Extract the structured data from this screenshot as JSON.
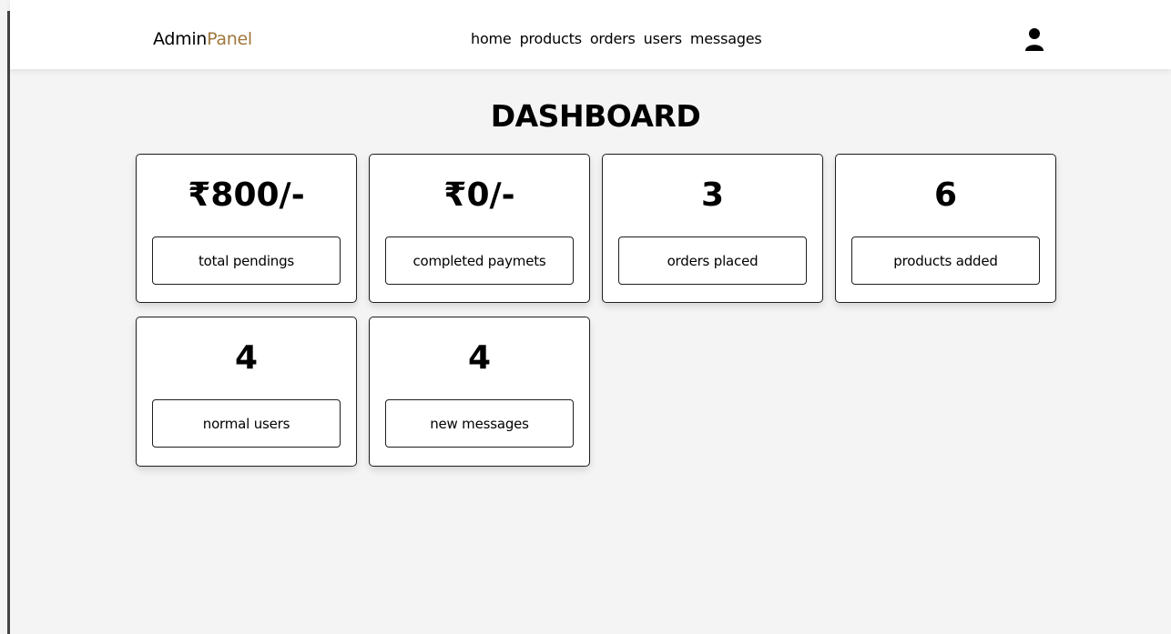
{
  "header": {
    "logo_main": "Admin",
    "logo_accent": "Panel",
    "nav": [
      "home",
      "products",
      "orders",
      "users",
      "messages"
    ],
    "user_icon": "user-icon"
  },
  "page": {
    "title": "DASHBOARD"
  },
  "stats": [
    {
      "value": "₹800/-",
      "label": "total pendings"
    },
    {
      "value": "₹0/-",
      "label": "completed paymets"
    },
    {
      "value": "3",
      "label": "orders placed"
    },
    {
      "value": "6",
      "label": "products added"
    },
    {
      "value": "4",
      "label": "normal users"
    },
    {
      "value": "4",
      "label": "new messages"
    }
  ],
  "colors": {
    "accent": "#a0773c",
    "background": "#f4f4f4",
    "header_bg": "#ffffff",
    "border": "#1e1e1e"
  }
}
